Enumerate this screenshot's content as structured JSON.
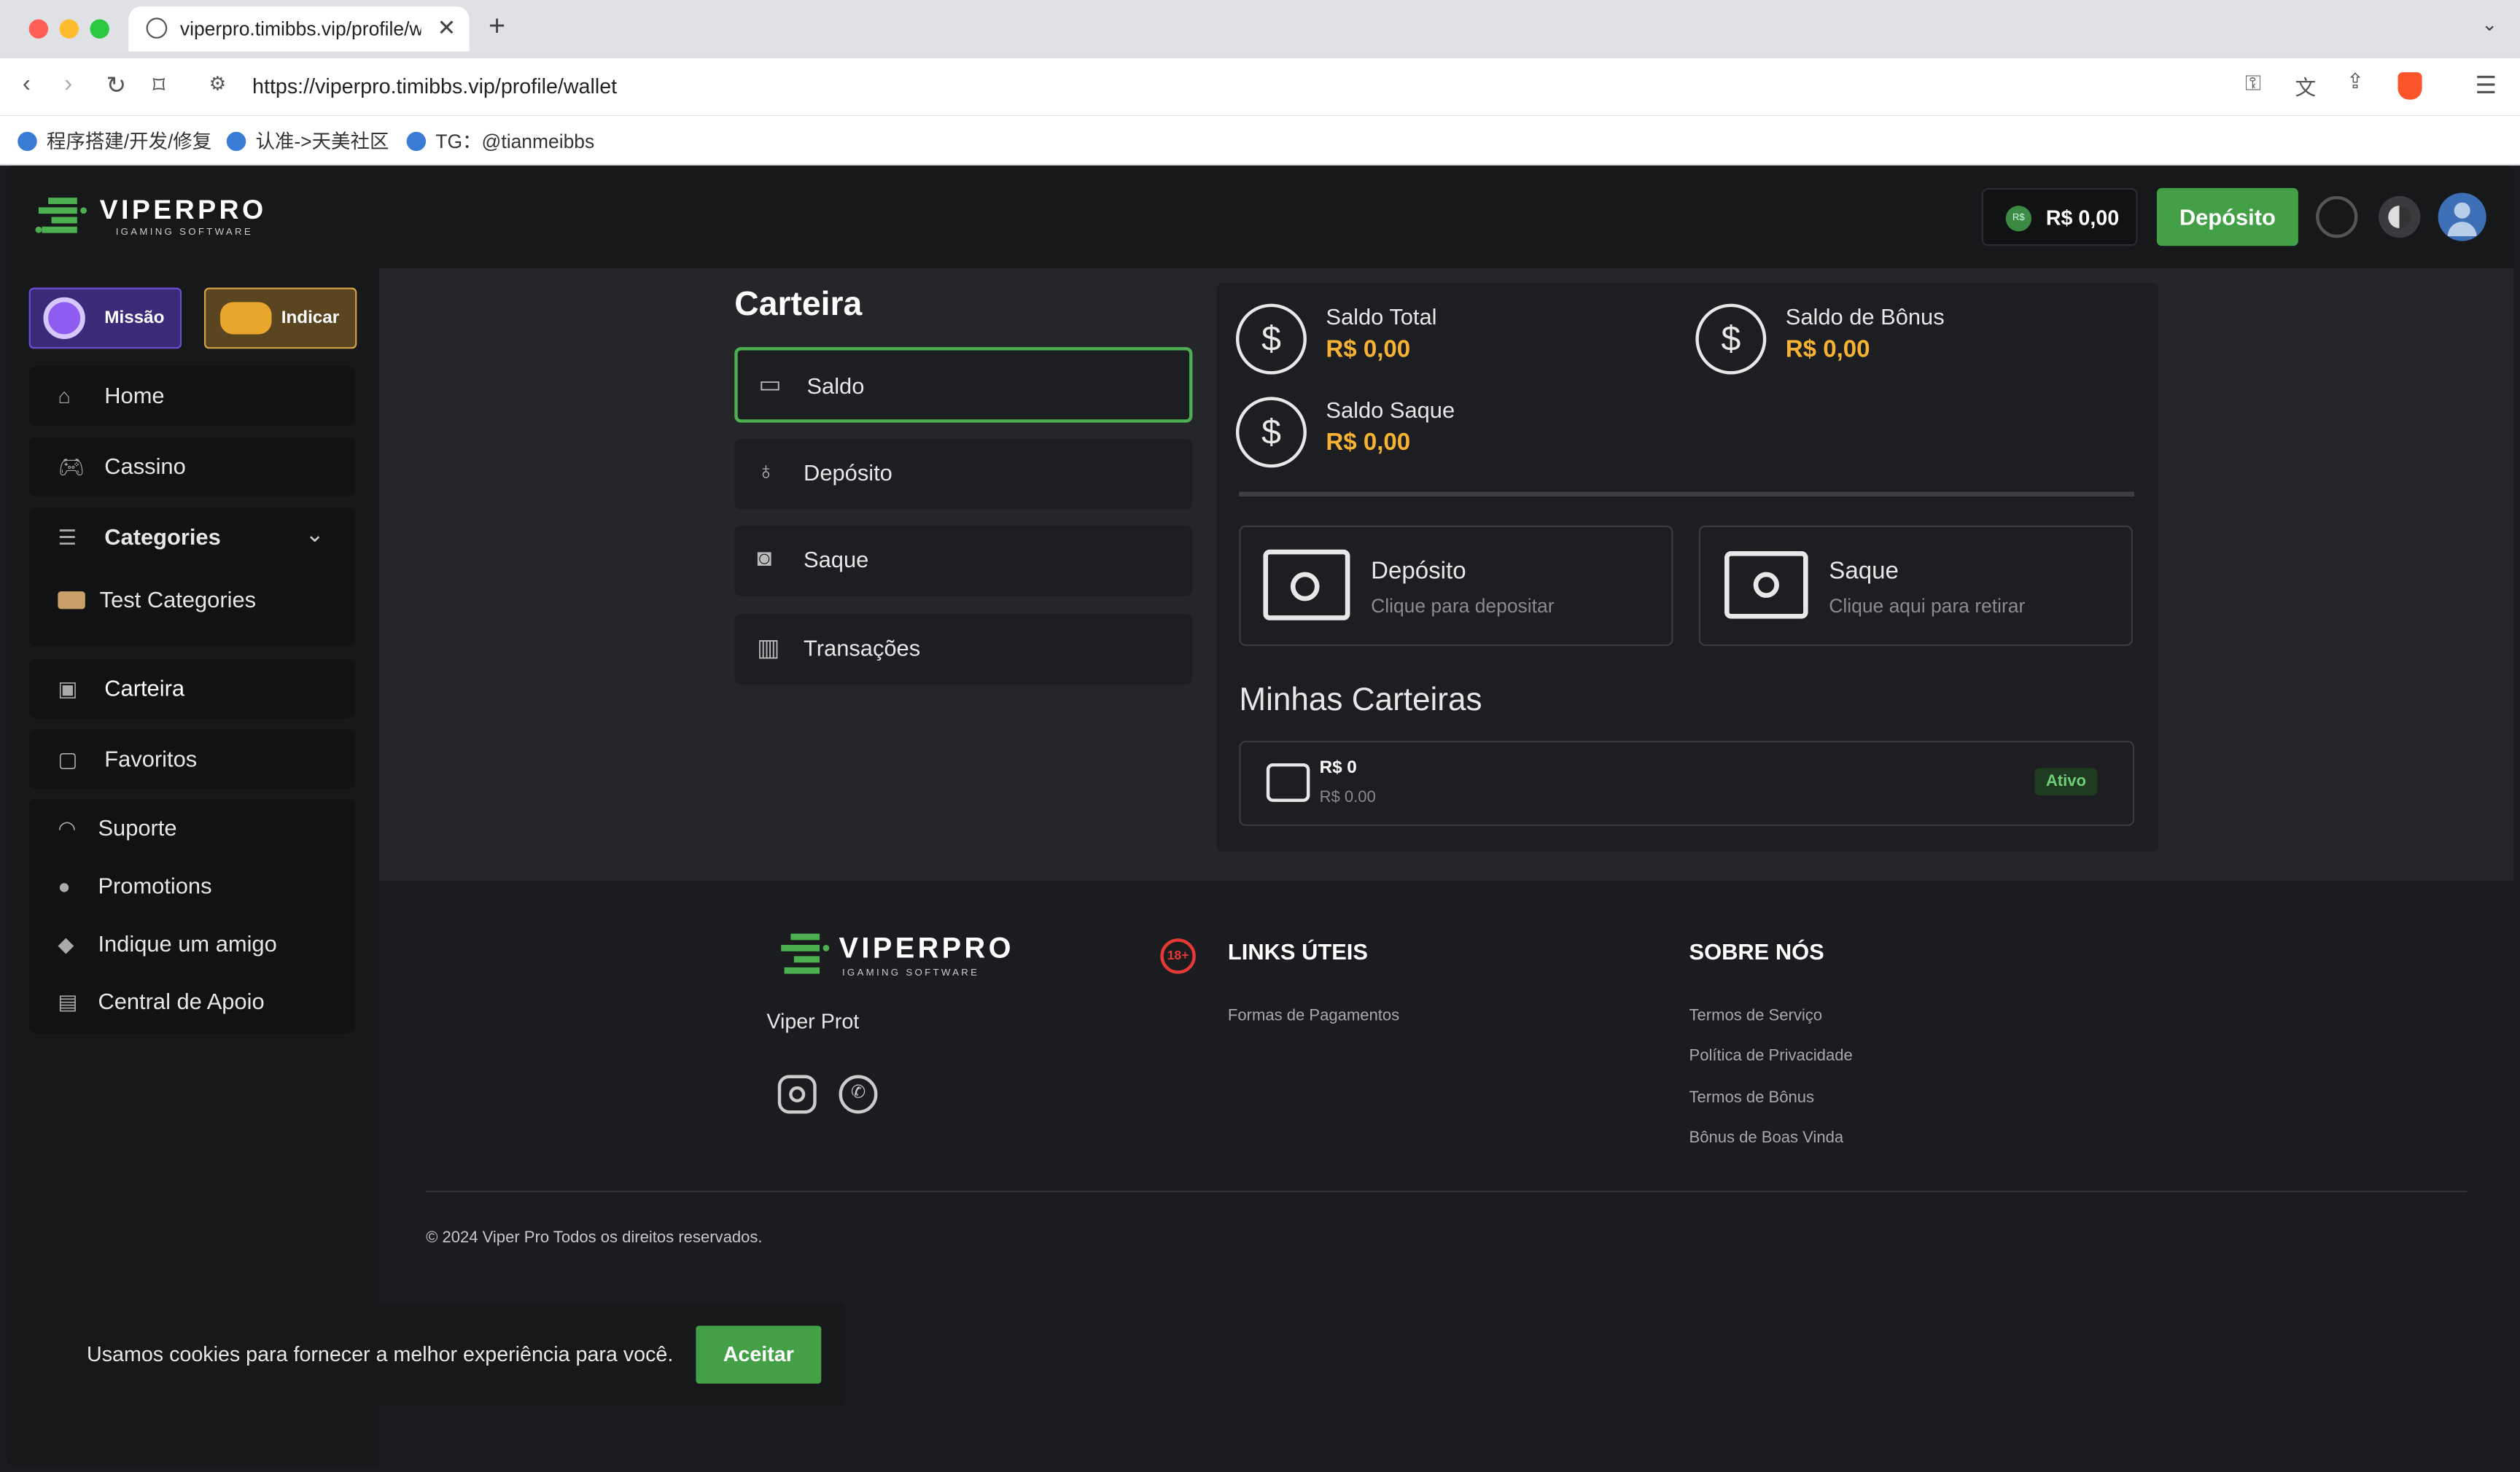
{
  "browser": {
    "tab_title": "viperpro.timibbs.vip/profile/wallet",
    "new_tab": "+",
    "url": "https://viperpro.timibbs.vip/profile/wallet",
    "bookmarks": [
      "程序搭建/开发/修复",
      "认准->天美社区",
      "TG：@tianmeibbs"
    ]
  },
  "header": {
    "logo_main": "VIPERPRO",
    "logo_sub": "IGAMING SOFTWARE",
    "balance": "R$ 0,00",
    "balance_badge": "R$",
    "deposit_button": "Depósito"
  },
  "sidebar": {
    "mission": "Missão",
    "invite": "Indicar",
    "items": {
      "home": "Home",
      "casino": "Cassino",
      "categories": "Categories",
      "test_categories": "Test Categories",
      "wallet": "Carteira",
      "favorites": "Favoritos",
      "support": "Suporte",
      "promotions": "Promotions",
      "refer": "Indique um amigo",
      "help": "Central de Apoio"
    }
  },
  "wallet": {
    "title": "Carteira",
    "menu": [
      "Saldo",
      "Depósito",
      "Saque",
      "Transações"
    ],
    "balances": {
      "total_label": "Saldo Total",
      "total_value": "R$ 0,00",
      "bonus_label": "Saldo de Bônus",
      "bonus_value": "R$ 0,00",
      "withdraw_label": "Saldo Saque",
      "withdraw_value": "R$ 0,00"
    },
    "actions": {
      "deposit_title": "Depósito",
      "deposit_sub": "Clique para depositar",
      "withdraw_title": "Saque",
      "withdraw_sub": "Clique aqui para retirar"
    },
    "my_wallets_title": "Minhas Carteiras",
    "wallet_row": {
      "amount": "R$ 0",
      "sub": "R$ 0.00",
      "status": "Ativo"
    }
  },
  "footer": {
    "brand": "Viper Prot",
    "age_badge": "18+",
    "links_title": "LINKS ÚTEIS",
    "links": [
      "Formas de Pagamentos"
    ],
    "about_title": "SOBRE NÓS",
    "about": [
      "Termos de Serviço",
      "Política de Privacidade",
      "Termos de Bônus",
      "Bônus de Boas Vinda"
    ],
    "copyright": "© 2024 Viper Pro Todos os direitos reservados."
  },
  "cookie": {
    "text": "Usamos cookies para fornecer a melhor experiência para você.",
    "accept": "Aceitar"
  },
  "colors": {
    "accent": "#4caf50",
    "gold": "#f5b233",
    "bg": "#1b1c1f"
  }
}
